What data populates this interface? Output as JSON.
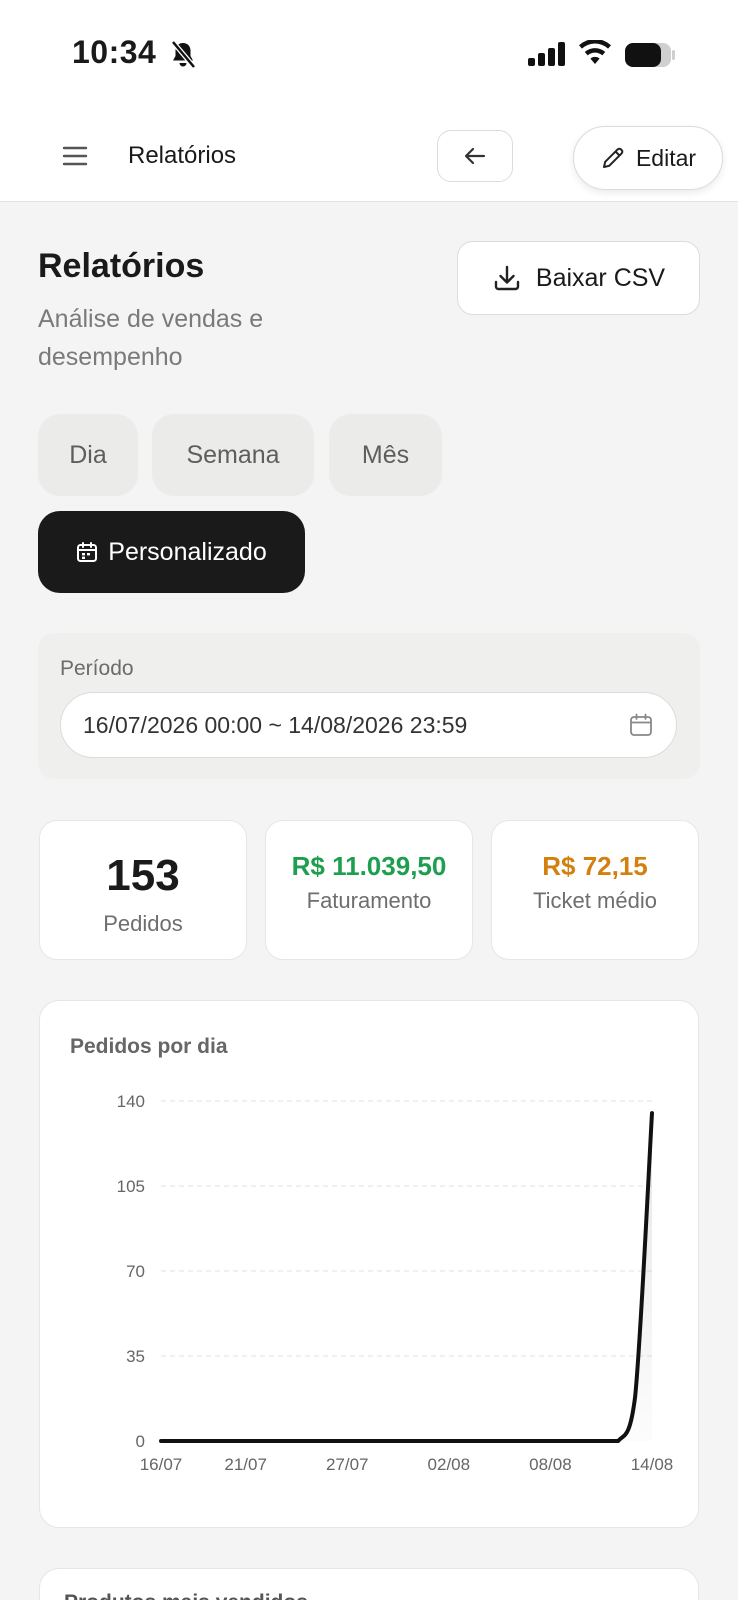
{
  "status_bar": {
    "time": "10:34"
  },
  "app_bar": {
    "title": "Relatórios",
    "edit_label": "Editar"
  },
  "header": {
    "title": "Relatórios",
    "subtitle": "Análise de vendas e desempenho",
    "csv_label": "Baixar CSV"
  },
  "filters": {
    "items": [
      {
        "label": "Dia"
      },
      {
        "label": "Semana"
      },
      {
        "label": "Mês"
      },
      {
        "label": "Personalizado"
      }
    ],
    "selected": "Personalizado"
  },
  "period": {
    "label": "Período",
    "value": "16/07/2026 00:00 ~ 14/08/2026 23:59"
  },
  "stats": [
    {
      "value": "153",
      "label": "Pedidos",
      "color": "#1a1a1a"
    },
    {
      "value": "R$ 11.039,50",
      "label": "Faturamento",
      "color": "#1e9e4f"
    },
    {
      "value": "R$ 72,15",
      "label": "Ticket médio",
      "color": "#d4800f"
    }
  ],
  "chart_data": {
    "type": "area",
    "title": "Pedidos por dia",
    "xlabel": "",
    "ylabel": "",
    "ylim": [
      0,
      140
    ],
    "yticks": [
      0,
      35,
      70,
      105,
      140
    ],
    "xtick_labels": [
      "16/07",
      "21/07",
      "27/07",
      "02/08",
      "08/08",
      "14/08"
    ],
    "grid": true,
    "x": [
      "16/07",
      "17/07",
      "18/07",
      "19/07",
      "20/07",
      "21/07",
      "22/07",
      "23/07",
      "24/07",
      "25/07",
      "26/07",
      "27/07",
      "28/07",
      "29/07",
      "30/07",
      "31/07",
      "01/08",
      "02/08",
      "03/08",
      "04/08",
      "05/08",
      "06/08",
      "07/08",
      "08/08",
      "09/08",
      "10/08",
      "11/08",
      "12/08",
      "13/08",
      "14/08"
    ],
    "series": [
      {
        "values": [
          0,
          0,
          0,
          0,
          0,
          0,
          0,
          0,
          0,
          0,
          0,
          0,
          0,
          0,
          0,
          0,
          0,
          0,
          0,
          0,
          0,
          0,
          0,
          0,
          0,
          0,
          0,
          0,
          18,
          135
        ]
      }
    ],
    "line_color": "#111111"
  },
  "next_section": {
    "title": "Produtos mais vendidos"
  }
}
